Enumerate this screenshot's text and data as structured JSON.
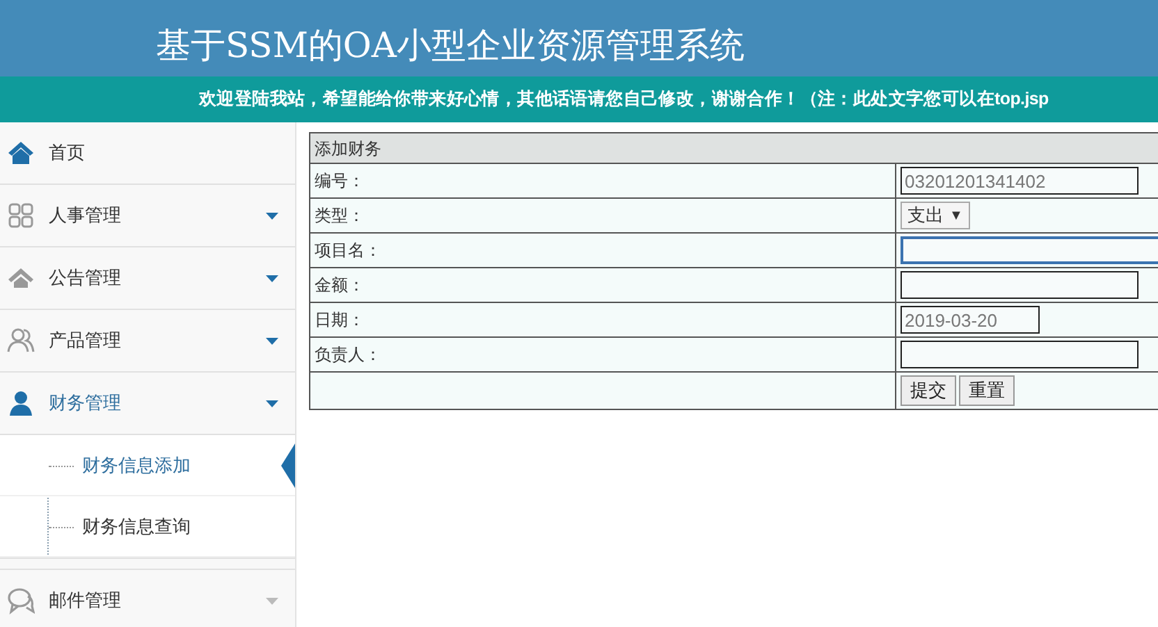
{
  "header": {
    "title": "基于SSM的OA小型企业资源管理系统",
    "notice": "欢迎登陆我站，希望能给你带来好心情，其他话语请您自己修改，谢谢合作！（注：此处文字您可以在top.jsp"
  },
  "sidebar": {
    "items": [
      {
        "label": "首页"
      },
      {
        "label": "人事管理",
        "expanded": false
      },
      {
        "label": "公告管理",
        "expanded": false
      },
      {
        "label": "产品管理",
        "expanded": false
      },
      {
        "label": "财务管理",
        "expanded": true,
        "children": [
          {
            "label": "财务信息添加",
            "selected": true
          },
          {
            "label": "财务信息查询",
            "selected": false
          }
        ]
      },
      {
        "label": "邮件管理",
        "expanded": false
      }
    ]
  },
  "form": {
    "title": "添加财务",
    "rows": [
      {
        "label": "编号：",
        "kind": "readonly",
        "value": "03201201341402"
      },
      {
        "label": "类型：",
        "kind": "select",
        "value": "支出",
        "arrow": "▼"
      },
      {
        "label": "项目名：",
        "kind": "input",
        "focused": true
      },
      {
        "label": "金额：",
        "kind": "input"
      },
      {
        "label": "日期：",
        "kind": "date",
        "value": "2019-03-20"
      },
      {
        "label": "负责人：",
        "kind": "input"
      }
    ],
    "buttons": [
      "提交",
      "重置"
    ]
  }
}
